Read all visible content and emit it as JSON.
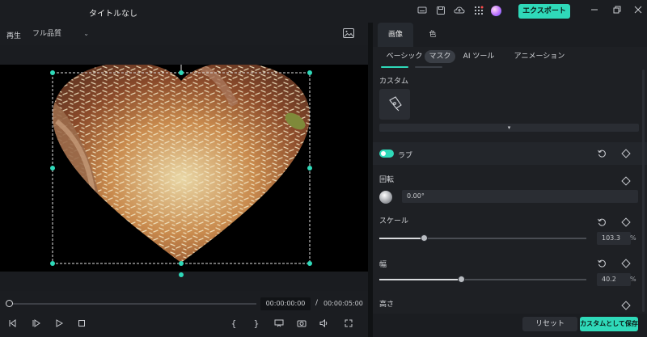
{
  "titlebar": {
    "title": "タイトルなし",
    "export_label": "エクスポート",
    "export_chevron": "⌄",
    "icons": [
      "monitor-icon",
      "save-icon",
      "cloud-icon",
      "apps-icon",
      "avatar"
    ],
    "window_controls": [
      "minimize",
      "restore",
      "close"
    ]
  },
  "player": {
    "label": "再生",
    "quality": "フル品質",
    "quality_chevron": "⌄"
  },
  "timeline": {
    "current_time": "00:00:00:00",
    "separator": "/",
    "total_time": "00:00:05:00"
  },
  "panel": {
    "main_tabs": [
      "画像",
      "色"
    ],
    "sub_tabs": [
      "ベーシック",
      "マスク",
      "AI ツール",
      "アニメーション"
    ],
    "active_sub_tab": "マスク",
    "custom_label": "カスタム",
    "expand_chevron": "▾",
    "mask_name": "ラブ",
    "rotation": {
      "label": "回転",
      "value": "0.00°"
    },
    "scale": {
      "label": "スケール",
      "value": "103.3",
      "unit": "%",
      "fraction": 0.22
    },
    "width": {
      "label": "幅",
      "value": "40.2",
      "unit": "%",
      "fraction": 0.4
    },
    "height": {
      "label": "高さ"
    },
    "reset_label": "リセット",
    "save_label": "カスタムとして保存"
  },
  "colors": {
    "accent": "#2fd9b9"
  }
}
